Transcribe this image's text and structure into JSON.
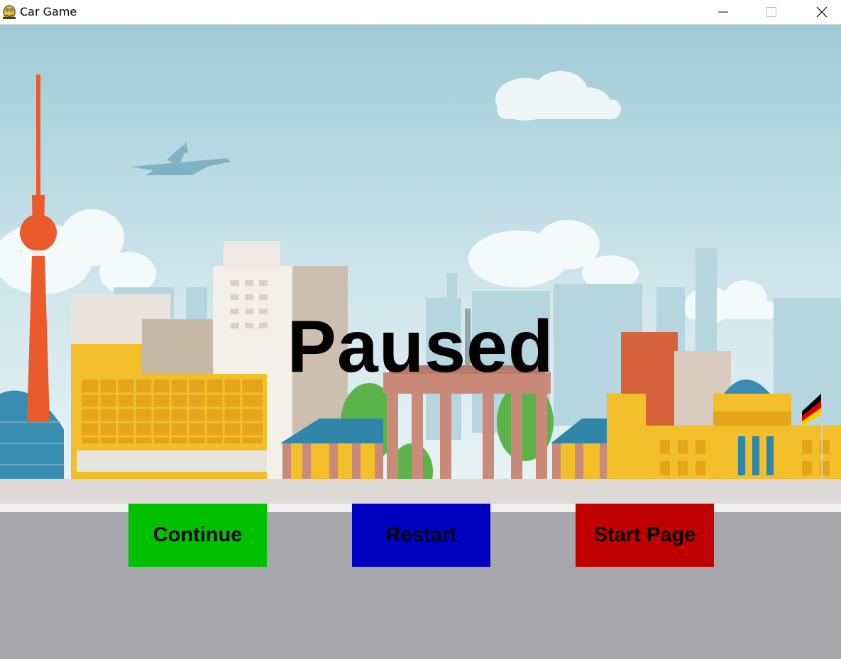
{
  "window": {
    "title": "Car Game",
    "icon": "pygame-snake-icon",
    "controls": [
      "minimize-icon",
      "maximize-icon",
      "close-icon"
    ]
  },
  "game": {
    "overlay_title": "Paused",
    "scene": "Berlin skyline background with TV tower, Brandenburg Gate, Reichstag, airplane and clouds over a grey road",
    "buttons": [
      {
        "label": "Continue",
        "color": "#00c000"
      },
      {
        "label": "Restart",
        "color": "#0000c0"
      },
      {
        "label": "Start Page",
        "color": "#c00000"
      }
    ]
  },
  "colors": {
    "sky_top": "#9fcbd6",
    "sky_bottom": "#e3f1f4",
    "road": "#a7a7ab",
    "tower": "#ea5a2b"
  }
}
